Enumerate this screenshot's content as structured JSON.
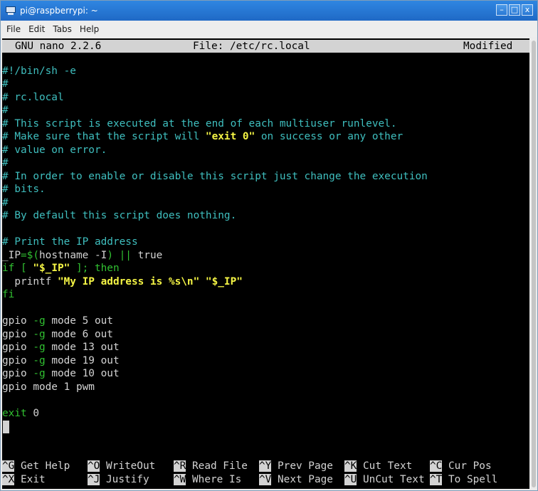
{
  "window": {
    "title": "pi@raspberrypi: ~",
    "buttons": {
      "minimize": "–",
      "maximize": "□",
      "close": "x"
    }
  },
  "menubar": {
    "items": [
      "File",
      "Edit",
      "Tabs",
      "Help"
    ]
  },
  "nano": {
    "version": "GNU nano 2.2.6",
    "file": "File: /etc/rc.local",
    "status": "Modified"
  },
  "code": {
    "l1": "#!/bin/sh -e",
    "l2": "#",
    "l3": "# rc.local",
    "l4": "#",
    "l5": "# This script is executed at the end of each multiuser runlevel.",
    "l6a": "# Make sure that the script will ",
    "l6b": "\"exit 0\"",
    "l6c": " on success or any other",
    "l7": "# value on error.",
    "l8": "#",
    "l9": "# In order to enable or disable this script just change the execution",
    "l10": "# bits.",
    "l11": "#",
    "l12": "# By default this script does nothing.",
    "l13": "# Print the IP address",
    "l14a": "_IP",
    "l14b": "=$(",
    "l14c": "hostname -I",
    "l14d": ") ",
    "l14e": "||",
    "l14f": " true",
    "l15a": "if [ ",
    "l15b": "\"$_IP\"",
    "l15c": " ]; then",
    "l16a": "  printf ",
    "l16b": "\"My IP address is %s\\n\" \"$_IP\"",
    "l17": "fi",
    "gpio1a": "gpio ",
    "gpio1b": "-g",
    "gpio1c": " mode 5 out",
    "gpio2c": " mode 6 out",
    "gpio3c": " mode 13 out",
    "gpio4c": " mode 19 out",
    "gpio5c": " mode 10 out",
    "gpio6": "gpio mode 1 pwm",
    "exit_kw": "exit",
    "exit_val": " 0"
  },
  "shortcuts": [
    {
      "key": "^G",
      "label": " Get Help"
    },
    {
      "key": "^O",
      "label": " WriteOut"
    },
    {
      "key": "^R",
      "label": " Read File"
    },
    {
      "key": "^Y",
      "label": " Prev Page"
    },
    {
      "key": "^K",
      "label": " Cut Text"
    },
    {
      "key": "^C",
      "label": " Cur Pos"
    },
    {
      "key": "^X",
      "label": " Exit"
    },
    {
      "key": "^J",
      "label": " Justify"
    },
    {
      "key": "^W",
      "label": " Where Is"
    },
    {
      "key": "^V",
      "label": " Next Page"
    },
    {
      "key": "^U",
      "label": " UnCut Text"
    },
    {
      "key": "^T",
      "label": " To Spell"
    }
  ],
  "colors": {
    "terminal_bg": "#000000",
    "comment": "#3fbfbf",
    "keyword": "#31c131",
    "string": "#f5f545",
    "text": "#d3d3d3",
    "titlebar": "#2f86e1"
  }
}
